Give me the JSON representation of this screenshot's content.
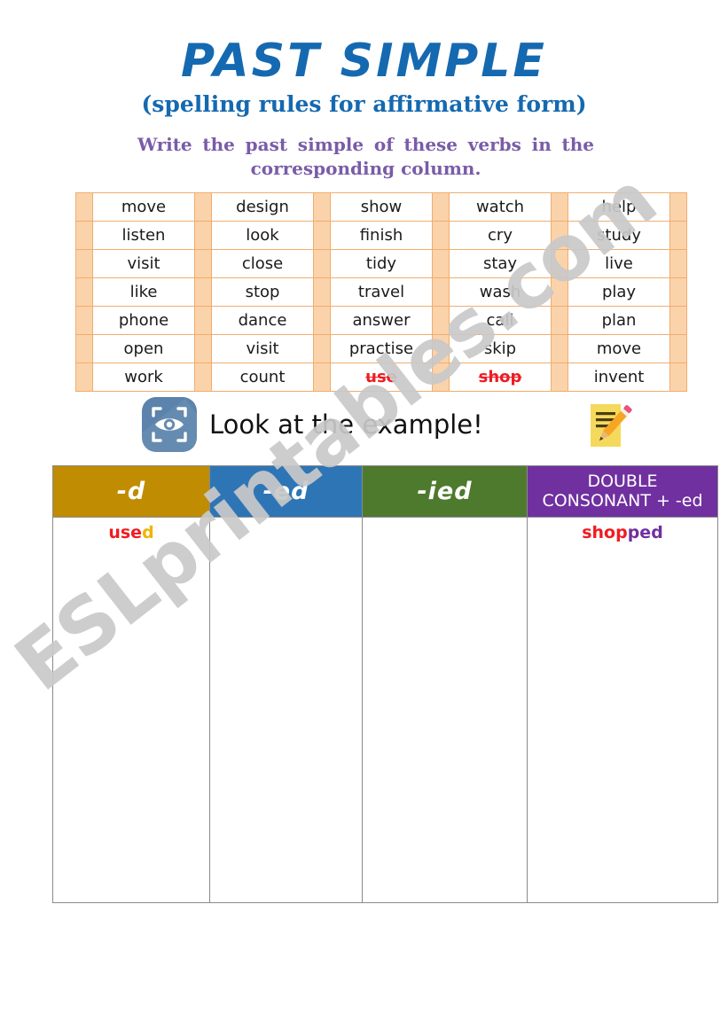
{
  "title": {
    "main": "PAST SIMPLE",
    "subtitle": "(spelling rules for affirmative form)",
    "color": "#1569b0"
  },
  "instructions": {
    "line1": "Write the past simple of these verbs in the",
    "line2": "corresponding column.",
    "color": "#7a5ca8"
  },
  "verb_table": {
    "border_color": "#f0ad6e",
    "spacer_color": "#fbd3ab",
    "strike_color": "#ee1c22",
    "rows": [
      [
        "move",
        "design",
        "show",
        "watch",
        "help"
      ],
      [
        "listen",
        "look",
        "finish",
        "cry",
        "study"
      ],
      [
        "visit",
        "close",
        "tidy",
        "stay",
        "live"
      ],
      [
        "like",
        "stop",
        "travel",
        "wash",
        "play"
      ],
      [
        "phone",
        "dance",
        "answer",
        "call",
        "plan"
      ],
      [
        "open",
        "visit",
        "practise",
        "skip",
        "move"
      ],
      [
        "work",
        "count",
        "use",
        "shop",
        "invent"
      ]
    ],
    "struck_cells": [
      [
        6,
        2
      ],
      [
        6,
        3
      ]
    ]
  },
  "example": {
    "label": "Look at the example!",
    "eye_icon": "eye-scan-icon",
    "note_icon": "note-pencil-icon",
    "badge_color": "#5b83ac"
  },
  "answer_table": {
    "columns": [
      {
        "header": "-d",
        "header_type": "suffix",
        "color": "#c08c02",
        "example_stem": "use",
        "example_suffix": "d",
        "suffix_color": "#f0b400"
      },
      {
        "header": "-ed",
        "header_type": "suffix",
        "color": "#2e75b6",
        "example_stem": "",
        "example_suffix": "",
        "suffix_color": "#2e75b6"
      },
      {
        "header": "-ied",
        "header_type": "suffix",
        "color": "#4e7a2e",
        "example_stem": "",
        "example_suffix": "",
        "suffix_color": "#4e7a2e"
      },
      {
        "header_line1": "DOUBLE",
        "header_line2": "CONSONANT + -ed",
        "header_type": "words",
        "color": "#7030a0",
        "example_stem": "shop",
        "example_suffix": "ped",
        "suffix_color": "#7030a0"
      }
    ],
    "border_color": "#8a8a8a"
  },
  "watermark": {
    "text": "ESLprintables.com",
    "color": "#c9c9c9"
  }
}
